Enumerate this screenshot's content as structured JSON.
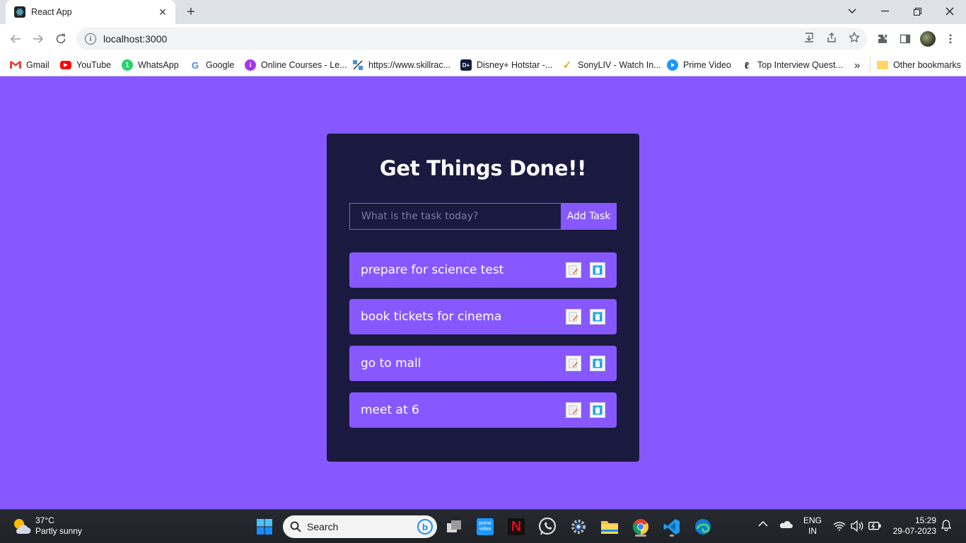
{
  "browser": {
    "tab_title": "React App",
    "url": "localhost:3000",
    "bookmarks": [
      {
        "label": "Gmail",
        "icon": "gmail-icon"
      },
      {
        "label": "YouTube",
        "icon": "youtube-icon"
      },
      {
        "label": "WhatsApp",
        "icon": "whatsapp-icon"
      },
      {
        "label": "Google",
        "icon": "google-icon"
      },
      {
        "label": "Online Courses - Le...",
        "icon": "courses-icon"
      },
      {
        "label": "https://www.skillrac...",
        "icon": "skillrack-icon"
      },
      {
        "label": "Disney+ Hotstar -...",
        "icon": "hotstar-icon"
      },
      {
        "label": "SonyLIV - Watch In...",
        "icon": "sonyliv-icon"
      },
      {
        "label": "Prime Video",
        "icon": "primevideo-icon"
      },
      {
        "label": "Top Interview Quest...",
        "icon": "leetcode-icon"
      }
    ],
    "overflow": "»",
    "other_bookmarks": "Other bookmarks"
  },
  "app": {
    "title": "Get Things Done!!",
    "input_placeholder": "What is the task today?",
    "add_button": "Add Task",
    "todos": [
      {
        "text": "prepare for science test"
      },
      {
        "text": "book tickets for cinema"
      },
      {
        "text": "go to mall"
      },
      {
        "text": "meet at 6"
      }
    ],
    "colors": {
      "background": "#8758ff",
      "card": "#1a1a40",
      "todo": "#8758ff"
    }
  },
  "taskbar": {
    "weather_temp": "37°C",
    "weather_desc": "Partly sunny",
    "search_label": "Search",
    "lang_top": "ENG",
    "lang_bottom": "IN",
    "time": "15:29",
    "date": "29-07-2023"
  }
}
